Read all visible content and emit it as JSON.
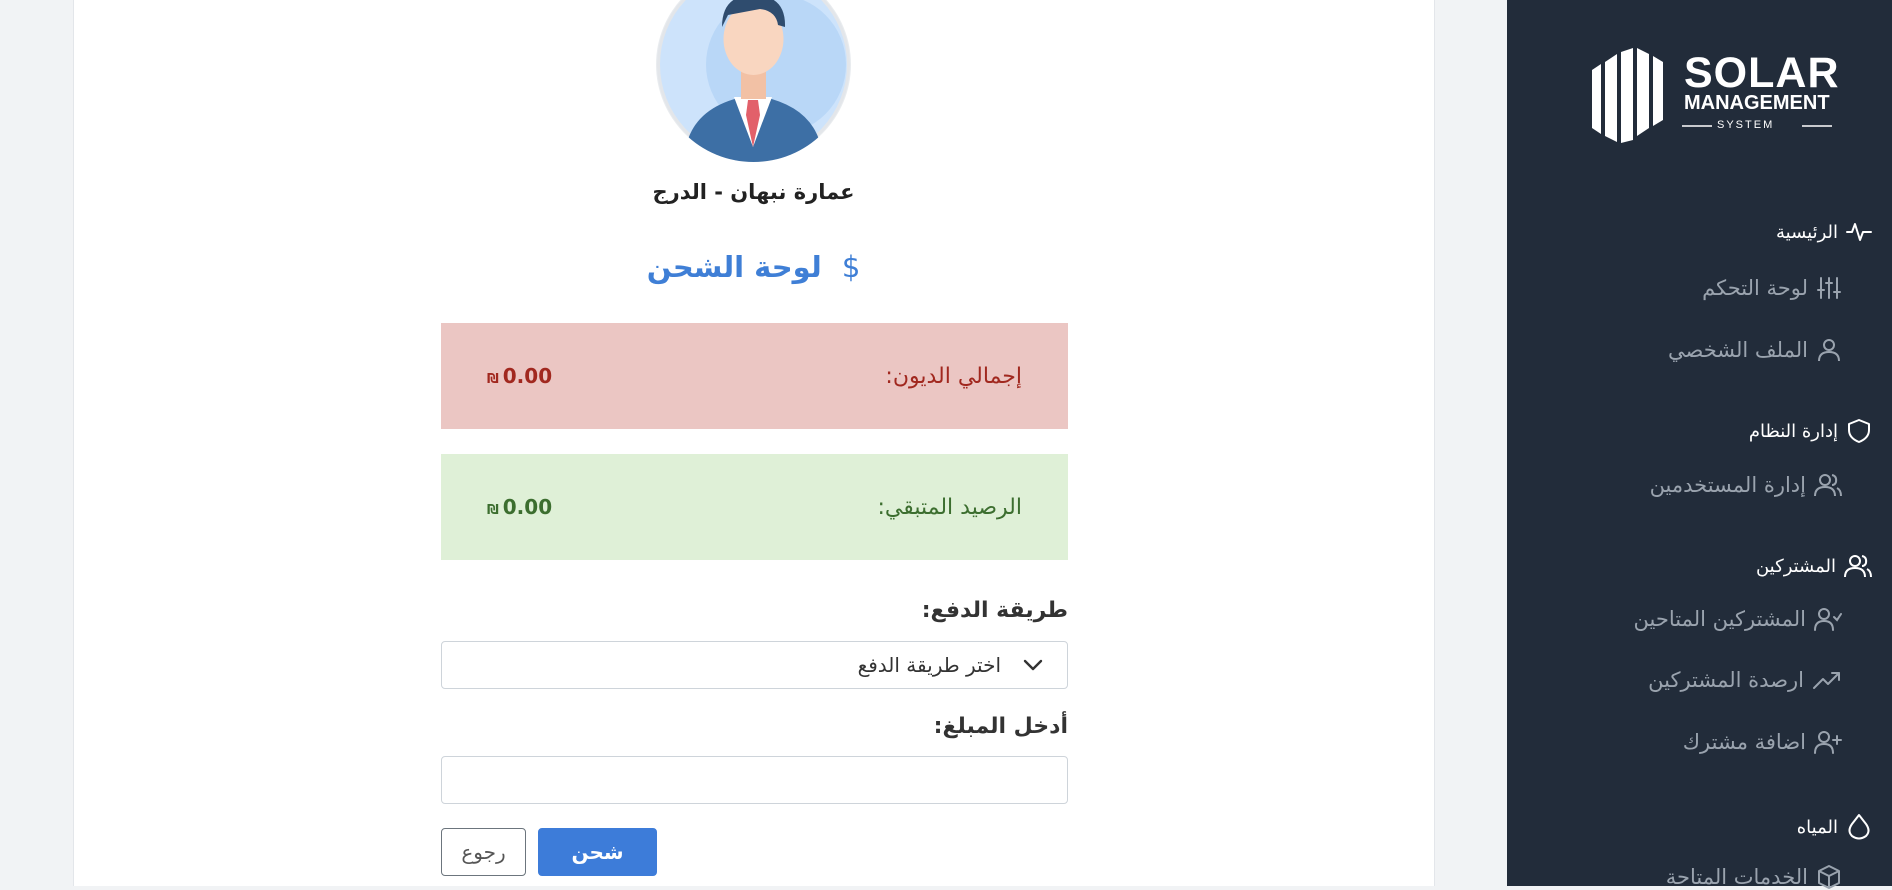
{
  "profile": {
    "name": "عمارة نبهان - الدرج"
  },
  "page": {
    "title": "لوحة الشحن",
    "title_icon": "dollar-icon"
  },
  "summary": {
    "debt_label": "إجمالي الديون:",
    "debt_value": "0.00",
    "balance_label": "الرصيد المتبقي:",
    "balance_value": "0.00",
    "currency": "₪"
  },
  "form": {
    "payment_method_label": "طريقة الدفع:",
    "payment_method_selected": "اختر طريقة الدفع",
    "amount_label": "أدخل المبلغ:",
    "amount_value": ""
  },
  "buttons": {
    "charge": "شحن",
    "back": "رجوع"
  },
  "logo": {
    "line1": "SOLAR",
    "line2": "MANAGEMENT",
    "line3": "SYSTEM"
  },
  "sidebar": {
    "items": [
      {
        "label": "الرئيسية",
        "icon": "activity-icon",
        "type": "head"
      },
      {
        "label": "لوحة التحكم",
        "icon": "sliders-icon",
        "type": "sub"
      },
      {
        "label": "الملف الشخصي",
        "icon": "user-icon",
        "type": "sub"
      },
      {
        "label": "إدارة النظام",
        "icon": "shield-icon",
        "type": "head"
      },
      {
        "label": "إدارة المستخدمين",
        "icon": "users-icon",
        "type": "sub"
      },
      {
        "label": "المشتركين",
        "icon": "users-icon",
        "type": "head"
      },
      {
        "label": "المشتركين المتاحين",
        "icon": "user-check-icon",
        "type": "sub"
      },
      {
        "label": "ارصدة المشتركين",
        "icon": "trending-up-icon",
        "type": "sub"
      },
      {
        "label": "اضافة مشترك",
        "icon": "user-plus-icon",
        "type": "sub"
      },
      {
        "label": "المياه",
        "icon": "droplet-icon",
        "type": "head"
      },
      {
        "label": "الخدمات المتاحة",
        "icon": "package-icon",
        "type": "sub"
      }
    ]
  },
  "colors": {
    "accent": "#3f7fd6",
    "sidebar_bg": "#222c3a",
    "debt_bg": "#ebc6c3",
    "debt_text": "#a1281f",
    "balance_bg": "#dff0d7",
    "balance_text": "#3c6e2f"
  }
}
